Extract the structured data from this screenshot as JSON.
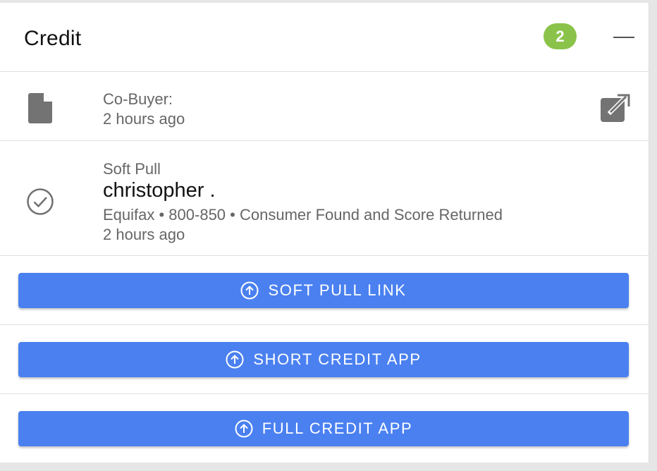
{
  "panel": {
    "title": "Credit",
    "badge_count": "2",
    "accent_color": "#8bc34a",
    "collapse_icon": "minus-icon"
  },
  "documents": [
    {
      "icon": "document-icon",
      "label": "Co-Buyer:",
      "time": "2 hours ago",
      "action_icon": "open-external-icon"
    }
  ],
  "credit_pull": {
    "icon": "check-circle-icon",
    "type": "Soft Pull",
    "name": "christopher .",
    "details": "Equifax • 800-850 • Consumer Found and Score Returned",
    "time": "2 hours ago"
  },
  "actions": {
    "button_color": "#4a80f0",
    "icon": "upload-circle-icon",
    "soft_pull_link": "SOFT PULL LINK",
    "short_credit_app": "SHORT CREDIT APP",
    "full_credit_app": "FULL CREDIT APP"
  }
}
